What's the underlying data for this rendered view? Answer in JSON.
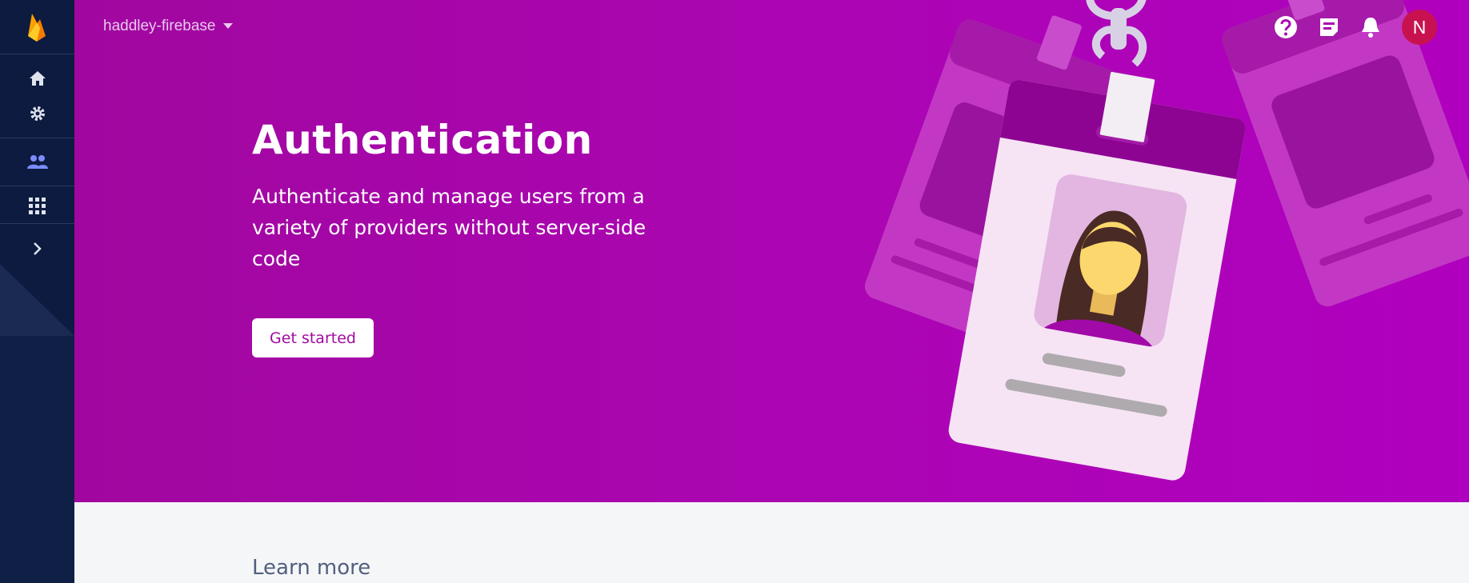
{
  "sidebar": {
    "items": [
      {
        "icon": "firebase-logo"
      },
      {
        "icon": "home-icon"
      },
      {
        "icon": "gear-icon"
      },
      {
        "icon": "people-icon"
      },
      {
        "icon": "apps-grid-icon"
      },
      {
        "icon": "chevron-right-icon"
      }
    ],
    "active_color": "#7c8cff"
  },
  "header": {
    "project_name": "haddley-firebase",
    "avatar_letter": "N"
  },
  "hero": {
    "title": "Authentication",
    "subtitle": "Authenticate and manage users from a variety of providers without server-side code",
    "cta_label": "Get started"
  },
  "learn_more": "Learn more",
  "colors": {
    "hero_bg": "#ab06b2",
    "sidebar_bg": "#0c1b3f",
    "avatar_bg": "#c8124f"
  }
}
